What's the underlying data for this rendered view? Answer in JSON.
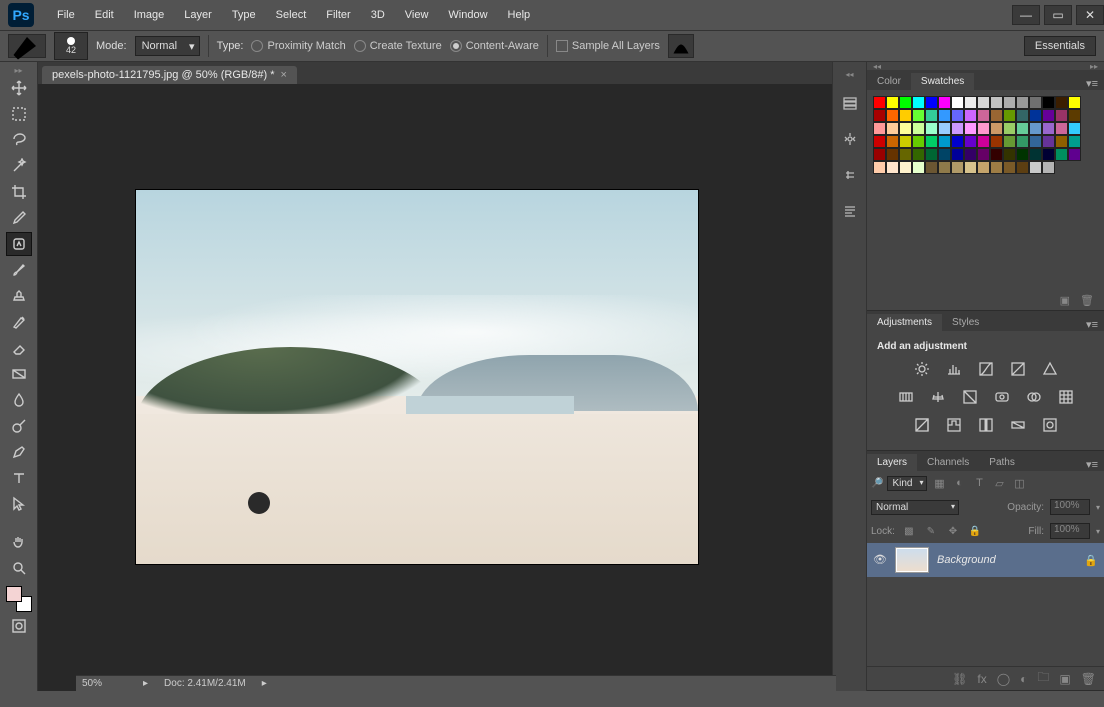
{
  "app": {
    "logo": "Ps"
  },
  "menus": [
    "File",
    "Edit",
    "Image",
    "Layer",
    "Type",
    "Select",
    "Filter",
    "3D",
    "View",
    "Window",
    "Help"
  ],
  "options": {
    "brush_size": "42",
    "mode_label": "Mode:",
    "mode_value": "Normal",
    "type_label": "Type:",
    "radios": [
      "Proximity Match",
      "Create Texture",
      "Content-Aware"
    ],
    "selected_radio": 2,
    "sample_all": "Sample All Layers",
    "workspace": "Essentials"
  },
  "document": {
    "tab_title": "pexels-photo-1121795.jpg @ 50% (RGB/8#) *"
  },
  "panels": {
    "color_tabs": [
      "Color",
      "Swatches"
    ],
    "adjustments_tabs": [
      "Adjustments",
      "Styles"
    ],
    "adjustments_title": "Add an adjustment",
    "layers_tabs": [
      "Layers",
      "Channels",
      "Paths"
    ],
    "layers": {
      "kind_label": "Kind",
      "blend": "Normal",
      "opacity_label": "Opacity:",
      "opacity_value": "100%",
      "lock_label": "Lock:",
      "fill_label": "Fill:",
      "fill_value": "100%",
      "items": [
        {
          "name": "Background"
        }
      ]
    }
  },
  "swatches": [
    "#ff0000",
    "#ffff00",
    "#00ff00",
    "#00ffff",
    "#0000ff",
    "#ff00ff",
    "#ffffff",
    "#ebebeb",
    "#d6d6d6",
    "#c2c2c2",
    "#adadad",
    "#999999",
    "#707070",
    "#000000",
    "#3b1e00",
    "#ffff00",
    "#a80000",
    "#ff6600",
    "#ffcc00",
    "#66ff33",
    "#33cc99",
    "#3399ff",
    "#6666ff",
    "#cc66ff",
    "#cc6699",
    "#996633",
    "#669900",
    "#336666",
    "#003399",
    "#660099",
    "#993366",
    "#5c3b00",
    "#ff9999",
    "#ffcc99",
    "#ffff99",
    "#ccff99",
    "#99ffcc",
    "#99ccff",
    "#cc99ff",
    "#ff99ff",
    "#ff99cc",
    "#cc9966",
    "#99cc66",
    "#66cc99",
    "#6699cc",
    "#9966cc",
    "#cc6699",
    "#33ccff",
    "#cc0000",
    "#cc6600",
    "#cccc00",
    "#66cc00",
    "#00cc66",
    "#0099cc",
    "#0000cc",
    "#6600cc",
    "#cc0099",
    "#993300",
    "#669933",
    "#339966",
    "#336699",
    "#663399",
    "#8f5f00",
    "#009e8f",
    "#990000",
    "#663300",
    "#666600",
    "#336600",
    "#006633",
    "#004466",
    "#000099",
    "#330066",
    "#660066",
    "#330000",
    "#333300",
    "#003300",
    "#003333",
    "#000033",
    "#008f5f",
    "#5f008f",
    "#ffccaa",
    "#ffe5cc",
    "#fff2cc",
    "#e5ffcc",
    "#6b5632",
    "#8f7a4a",
    "#b09a68",
    "#d6c28c",
    "#c4a46b",
    "#9e7d45",
    "#7a5a28",
    "#5c3e12",
    "#c9c9c9",
    "#b4b4b4"
  ],
  "status": {
    "zoom": "50%",
    "doc": "Doc: 2.41M/2.41M"
  }
}
